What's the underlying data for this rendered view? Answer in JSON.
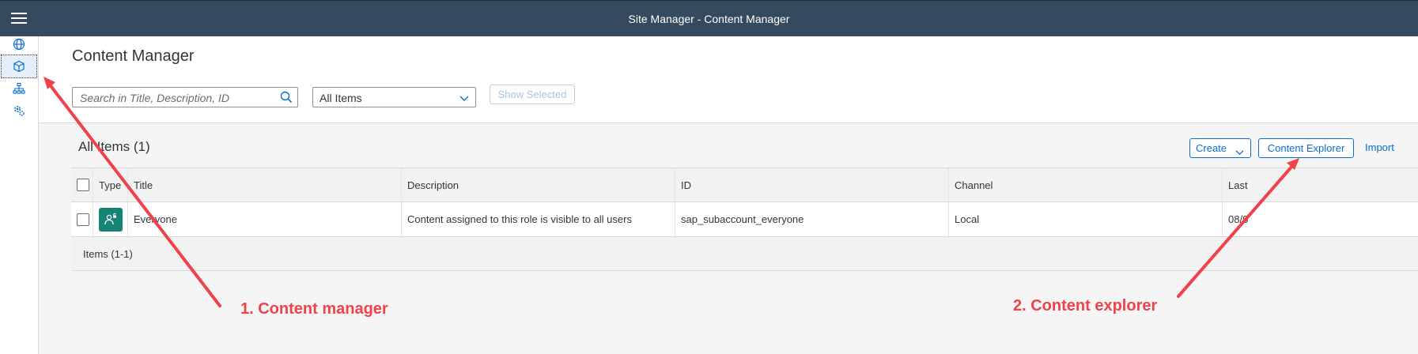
{
  "shell": {
    "title": "Site Manager - Content Manager"
  },
  "sidenav": {
    "items": [
      {
        "icon": "globe-icon"
      },
      {
        "icon": "cube-icon",
        "active": true
      },
      {
        "icon": "hierarchy-icon"
      },
      {
        "icon": "settings-icon"
      }
    ]
  },
  "header": {
    "page_title": "Content Manager",
    "search_placeholder": "Search in Title, Description, ID",
    "filter_value": "All Items",
    "show_selected_label": "Show Selected"
  },
  "table": {
    "title": "All Items (1)",
    "create_label": "Create",
    "content_explorer_label": "Content Explorer",
    "import_label": "Import",
    "columns": [
      "Type",
      "Title",
      "Description",
      "ID",
      "Channel",
      "Last"
    ],
    "rows": [
      {
        "title": "Everyone",
        "description": "Content assigned to this role is visible to all users",
        "id": "sap_subaccount_everyone",
        "channel": "Local",
        "last": "08/0"
      }
    ],
    "footer": "Items (1-1)"
  },
  "annotations": {
    "first": "1. Content manager",
    "second": "2. Content explorer",
    "color": "#f0424a"
  },
  "colors": {
    "shellbar": "#354a5f",
    "accent": "#0a6ed1",
    "role_icon": "#168375"
  }
}
